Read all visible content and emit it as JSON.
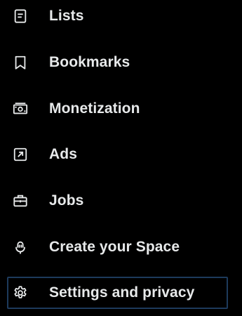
{
  "menu": {
    "items": [
      {
        "label": "Lists",
        "icon": "list-icon"
      },
      {
        "label": "Bookmarks",
        "icon": "bookmark-icon"
      },
      {
        "label": "Monetization",
        "icon": "money-icon"
      },
      {
        "label": "Ads",
        "icon": "ads-icon"
      },
      {
        "label": "Jobs",
        "icon": "briefcase-icon"
      },
      {
        "label": "Create your Space",
        "icon": "microphone-icon"
      },
      {
        "label": "Settings and privacy",
        "icon": "gear-icon"
      }
    ],
    "focused_item": "Settings and privacy"
  },
  "colors": {
    "background": "#000000",
    "text": "#e7e9ea",
    "focus_border": "#1d3a5c"
  }
}
